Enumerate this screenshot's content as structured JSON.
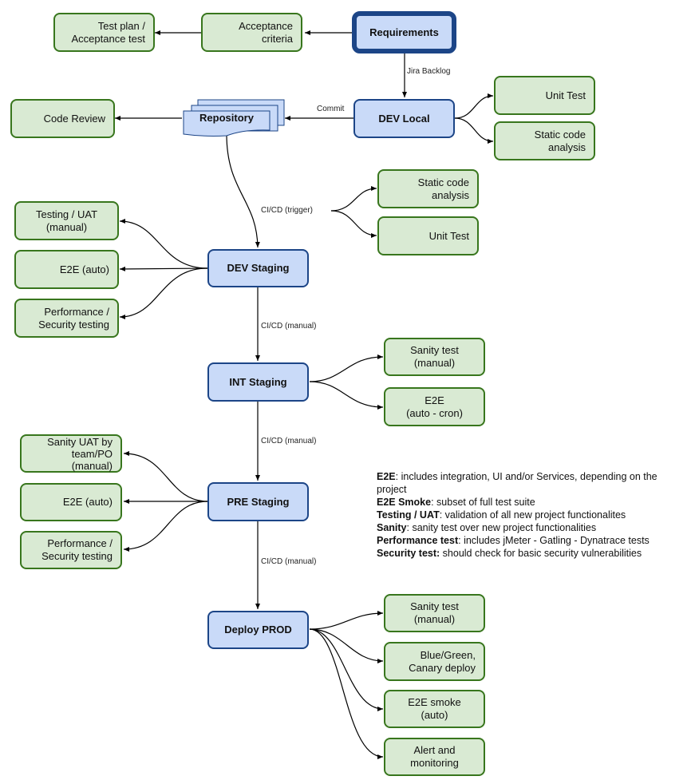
{
  "colors": {
    "test_fill": "#d9ead3",
    "test_border": "#38761d",
    "stage_fill": "#c9daf8",
    "stage_border": "#1c4587",
    "edge": "#000000"
  },
  "nodes": {
    "requirements": "Requirements",
    "acceptance_criteria": "Acceptance\ncriteria",
    "test_plan": "Test plan /\nAcceptance test",
    "dev_local": "DEV Local",
    "repository": "Repository",
    "code_review": "Code Review",
    "dev_local_unit_test": "Unit Test",
    "dev_local_static": "Static code\nanalysis",
    "trigger_static": "Static code\nanalysis",
    "trigger_unit_test": "Unit Test",
    "dev_staging": "DEV Staging",
    "dev_testing_uat": "Testing / UAT\n(manual)",
    "dev_e2e": "E2E (auto)",
    "dev_perf": "Performance /\nSecurity testing",
    "int_staging": "INT Staging",
    "int_sanity": "Sanity test\n(manual)",
    "int_e2e": "E2E\n(auto - cron)",
    "pre_staging": "PRE Staging",
    "pre_sanity_uat": "Sanity UAT by\nteam/PO\n(manual)",
    "pre_e2e": "E2E (auto)",
    "pre_perf": "Performance /\nSecurity testing",
    "deploy_prod": "Deploy PROD",
    "prod_sanity": "Sanity test\n(manual)",
    "prod_bluegreen": "Blue/Green,\nCanary deploy",
    "prod_e2e_smoke": "E2E smoke\n(auto)",
    "prod_alert": "Alert and\nmonitoring"
  },
  "edge_labels": {
    "jira_backlog": "Jira Backlog",
    "commit": "Commit",
    "cicd_trigger": "CI/CD (trigger)",
    "cicd_manual_1": "CI/CD (manual)",
    "cicd_manual_2": "CI/CD (manual)",
    "cicd_manual_3": "CI/CD (manual)"
  },
  "legend": [
    {
      "term": "E2E",
      "desc": ": includes integration, UI and/or Services, depending on the project"
    },
    {
      "term": "E2E Smoke",
      "desc": ": subset of full test suite"
    },
    {
      "term": "Testing / UAT",
      "desc": ": validation of all new project functionalites"
    },
    {
      "term": "Sanity",
      "desc": ": sanity test over new project functionalities"
    },
    {
      "term": "Performance test",
      "desc": ": includes jMeter - Gatling - Dynatrace tests"
    },
    {
      "term": "Security test:",
      "desc": " should check for basic security vulnerabilities"
    }
  ]
}
